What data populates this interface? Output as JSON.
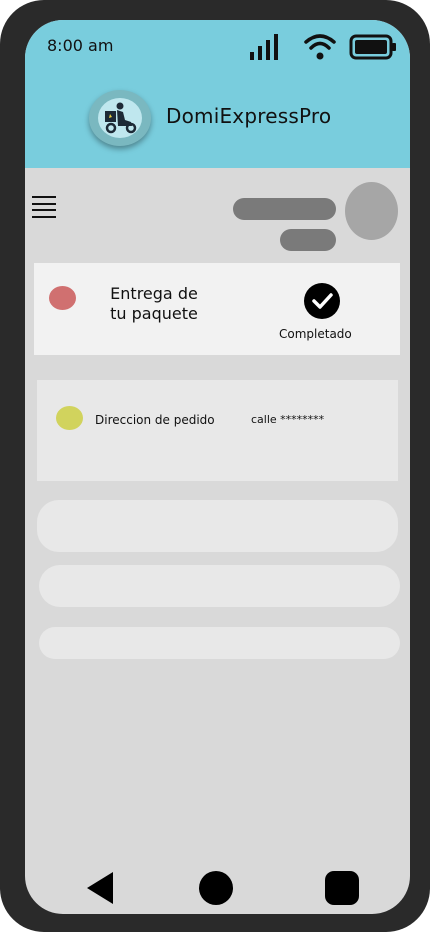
{
  "status_bar": {
    "time": "8:00 am"
  },
  "app": {
    "name": "DomiExpressPro"
  },
  "delivery_card": {
    "title": "Entrega de tu paquete",
    "status": "Completado"
  },
  "order_card": {
    "label": "Direccion de pedido",
    "value": "calle ********"
  },
  "icons": {
    "signal": "cellular-signal-icon",
    "wifi": "wifi-icon",
    "battery": "battery-icon",
    "logo": "delivery-scooter-icon",
    "menu": "hamburger-menu-icon",
    "check": "check-icon",
    "back": "back-triangle-icon",
    "home": "home-circle-icon",
    "recent": "recent-apps-icon"
  },
  "colors": {
    "header": "#79cddd",
    "screen": "#d9d9d9",
    "status_dot_delivery": "#d07070",
    "status_dot_order": "#d1d35d"
  }
}
